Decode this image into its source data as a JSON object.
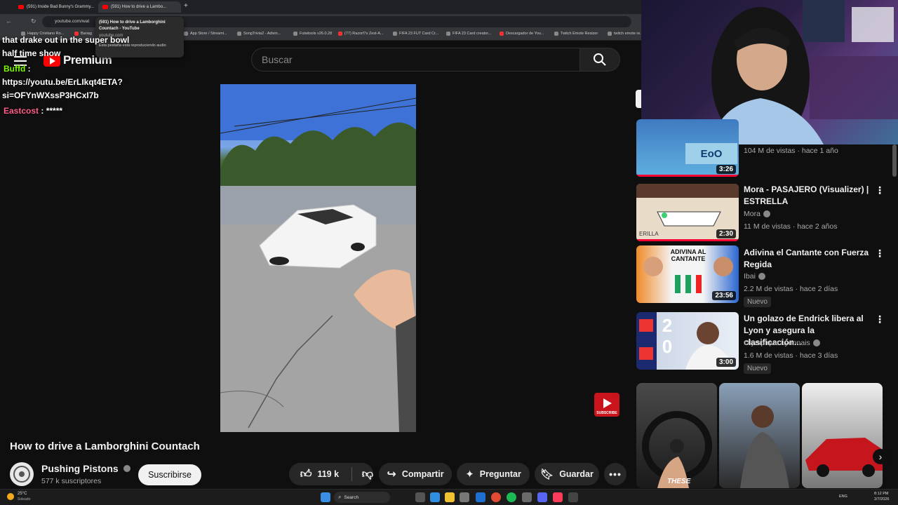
{
  "browser": {
    "tabs": [
      {
        "label": "(591) Inside Bad Bunny's Grammy..."
      },
      {
        "label": "(591) How to drive a Lambo..."
      }
    ],
    "url": "youtube.com/wat",
    "bookmarks": [
      "Happy Cristiano Ro...",
      "Banag",
      "App Store / Streami...",
      "SongTrivia2 - Adivin...",
      "Futwtools v26.0.28",
      "(77) Razorf7s Zest-A...",
      "FIFA 23 FUT Card Cr...",
      "FIFA 23 Card creator...",
      "Descargador de You...",
      "Twitch Emote Resizer",
      "twitch emote re..."
    ],
    "tooltip": {
      "title": "(591) How to drive a Lamborghini Countach - YouTube",
      "domain": "youtube.com",
      "audio": "Esta pestaña está reproduciendo audio"
    }
  },
  "youtube": {
    "logo_text": "Premium",
    "search_placeholder": "Buscar"
  },
  "chat": {
    "line1": "that drake out in the super bowl",
    "line2": "half time show",
    "user1": "Buffd",
    "user1_sep": " :",
    "link1": "https://youtu.be/ErLIkqt4ETA?",
    "link2": "si=OFYnWXssP3HCxI7b",
    "user2": "Eastcost",
    "user2_msg": " : *****"
  },
  "video": {
    "title": "How to drive a Lamborghini Countach",
    "subscribe_watermark": "SUBSCRIBE",
    "channel": "Pushing Pistons",
    "subscribers": "577 k suscriptores",
    "subscribe_label": "Suscribirse",
    "likes": "119 k",
    "share_label": "Compartir",
    "ask_label": "Preguntar",
    "save_label": "Guardar"
  },
  "recommendations": [
    {
      "title": "",
      "channel": "",
      "meta": "104 M de vistas · hace 1 año",
      "duration": "3:26",
      "thumb_text": "EoO"
    },
    {
      "title": "Mora - PASAJERO (Visualizer) | ESTRELLA",
      "channel": "Mora",
      "meta": "11 M de vistas · hace 2 años",
      "duration": "2:30",
      "thumb_text": "ERILLA"
    },
    {
      "title": "Adivina el Cantante con Fuerza Regida",
      "channel": "Ibai",
      "meta": "2.2 M de vistas · hace 2 días",
      "duration": "23:56",
      "badge": "Nuevo",
      "thumb_text": "ADIVINA AL CANTANTE"
    },
    {
      "title": "Un golazo de Endrick libera al Lyon y asegura la clasificación...",
      "channel": "Olympique Lyonnais",
      "meta": "1.6 M de vistas · hace 3 días",
      "duration": "3:00",
      "badge": "Nuevo",
      "thumb_text": "2 0"
    }
  ],
  "shorts": [
    {
      "caption": "THESE"
    },
    {
      "caption": ""
    },
    {
      "caption": ""
    }
  ],
  "taskbar": {
    "weather_temp": "25°C",
    "weather_desc": "Soleado",
    "search": "Search",
    "lang": "ENG",
    "time": "8:12 PM",
    "date": "2/7/2026"
  },
  "colors": {
    "youtube_red": "#ff0000",
    "chat_green": "#7cfc00",
    "chat_pink": "#ff5c8a"
  }
}
